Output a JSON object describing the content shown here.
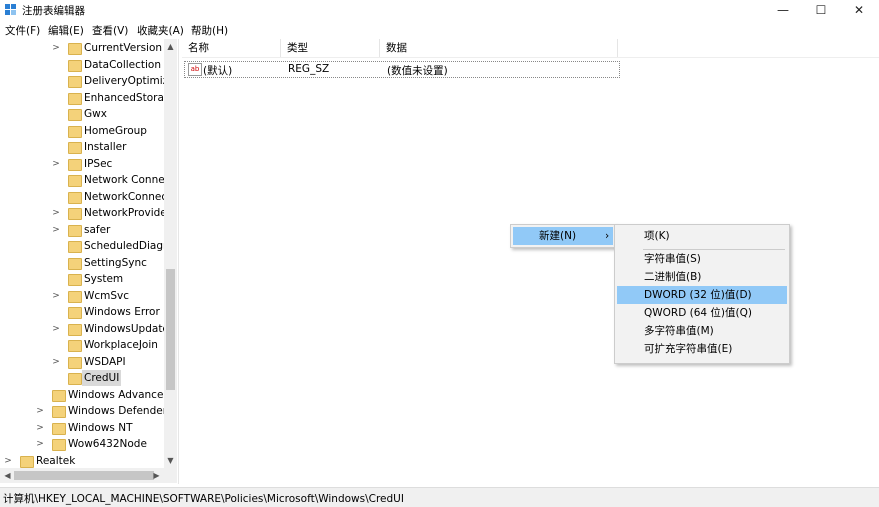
{
  "window": {
    "title": "注册表编辑器",
    "controls": {
      "minimize": "—",
      "maximize": "☐",
      "close": "✕"
    }
  },
  "menubar": [
    "文件(F)",
    "编辑(E)",
    "查看(V)",
    "收藏夹(A)",
    "帮助(H)"
  ],
  "tree": {
    "items": [
      {
        "label": "CurrentVersion",
        "expandable": true
      },
      {
        "label": "DataCollection",
        "expandable": false
      },
      {
        "label": "DeliveryOptimiza",
        "expandable": false
      },
      {
        "label": "EnhancedStorag",
        "expandable": false
      },
      {
        "label": "Gwx",
        "expandable": false
      },
      {
        "label": "HomeGroup",
        "expandable": false
      },
      {
        "label": "Installer",
        "expandable": false
      },
      {
        "label": "IPSec",
        "expandable": true
      },
      {
        "label": "Network Connec",
        "expandable": false
      },
      {
        "label": "NetworkConnect",
        "expandable": false
      },
      {
        "label": "NetworkProvider",
        "expandable": true
      },
      {
        "label": "safer",
        "expandable": true
      },
      {
        "label": "ScheduledDiagn",
        "expandable": false
      },
      {
        "label": "SettingSync",
        "expandable": false
      },
      {
        "label": "System",
        "expandable": false
      },
      {
        "label": "WcmSvc",
        "expandable": true
      },
      {
        "label": "Windows Error F",
        "expandable": false
      },
      {
        "label": "WindowsUpdate",
        "expandable": true
      },
      {
        "label": "WorkplaceJoin",
        "expandable": false
      },
      {
        "label": "WSDAPI",
        "expandable": true
      },
      {
        "label": "CredUI",
        "expandable": false,
        "selected": true
      },
      {
        "label": "Windows Advanced",
        "expandable": false
      },
      {
        "label": "Windows Defender",
        "expandable": true
      },
      {
        "label": "Windows NT",
        "expandable": true
      },
      {
        "label": "Wow6432Node",
        "expandable": true
      },
      {
        "label": "Realtek",
        "expandable": true
      }
    ]
  },
  "list": {
    "columns": [
      "名称",
      "类型",
      "数据"
    ],
    "rows": [
      {
        "name": "(默认)",
        "type": "REG_SZ",
        "data": "(数值未设置)",
        "icon": "ab"
      }
    ]
  },
  "context_menu": {
    "new_label": "新建(N)",
    "arrow": "›"
  },
  "submenu": {
    "items": [
      "项(K)",
      "字符串值(S)",
      "二进制值(B)",
      "DWORD (32 位)值(D)",
      "QWORD (64 位)值(Q)",
      "多字符串值(M)",
      "可扩充字符串值(E)"
    ],
    "highlighted_index": 3
  },
  "statusbar": {
    "path": "计算机\\HKEY_LOCAL_MACHINE\\SOFTWARE\\Policies\\Microsoft\\Windows\\CredUI"
  },
  "colors": {
    "highlight": "#91c9f7",
    "folder": "#f4d27a",
    "selected": "#d9d9d9"
  }
}
